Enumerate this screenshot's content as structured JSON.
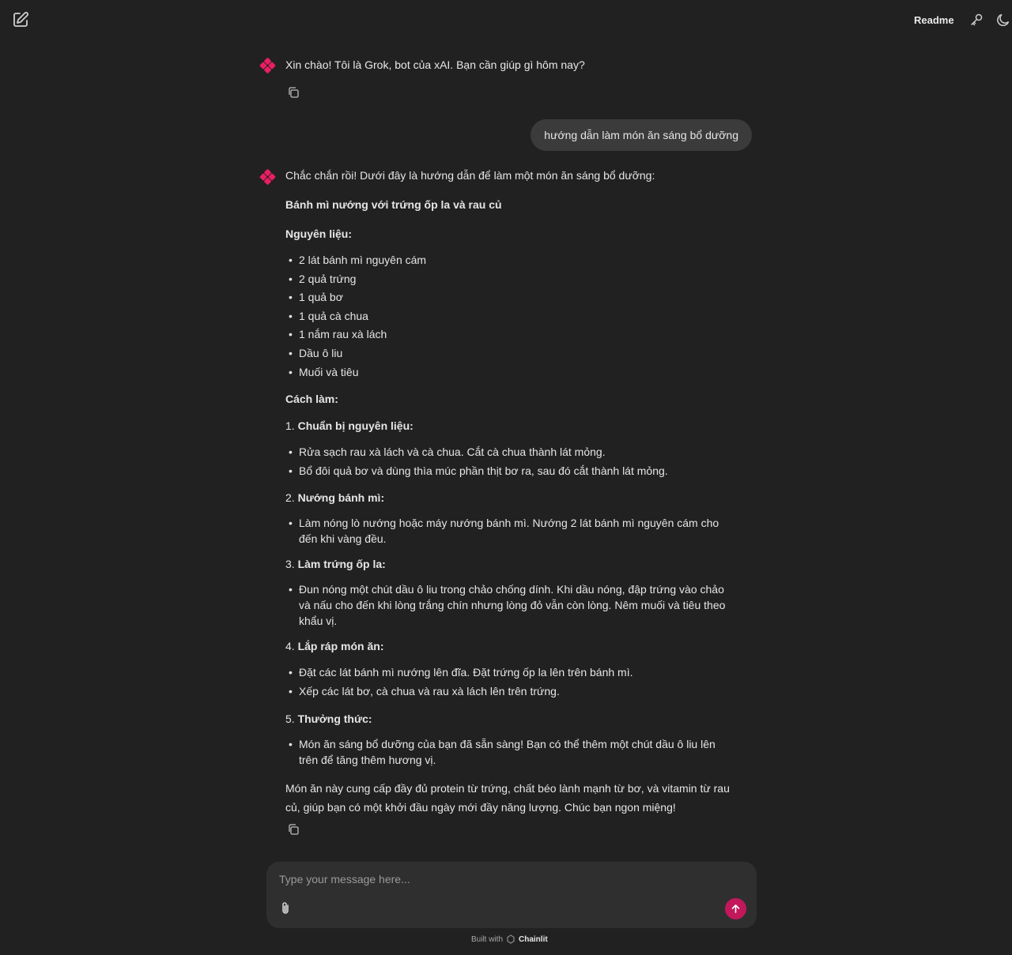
{
  "header": {
    "readme_label": "Readme"
  },
  "messages": {
    "greeting": "Xin chào! Tôi là Grok, bot của xAI. Bạn cần giúp gì hôm nay?",
    "user_message": "hướng dẫn làm món ăn sáng bổ dưỡng",
    "response": {
      "intro": "Chắc chắn rồi! Dưới đây là hướng dẫn để làm một món ăn sáng bổ dưỡng:",
      "dish_title": "Bánh mì nướng với trứng ốp la và rau củ",
      "ingredients_heading": "Nguyên liệu:",
      "ingredients": [
        "2 lát bánh mì nguyên cám",
        "2 quả trứng",
        "1 quả bơ",
        "1 quả cà chua",
        "1 nắm rau xà lách",
        "Dầu ô liu",
        "Muối và tiêu"
      ],
      "method_heading": "Cách làm:",
      "steps": [
        {
          "num": "1.",
          "title": "Chuẩn bị nguyên liệu:",
          "bullets": [
            "Rửa sạch rau xà lách và cà chua. Cắt cà chua thành lát mỏng.",
            "Bổ đôi quả bơ và dùng thìa múc phần thịt bơ ra, sau đó cắt thành lát mỏng."
          ]
        },
        {
          "num": "2.",
          "title": "Nướng bánh mì:",
          "bullets": [
            "Làm nóng lò nướng hoặc máy nướng bánh mì. Nướng 2 lát bánh mì nguyên cám cho đến khi vàng đều."
          ]
        },
        {
          "num": "3.",
          "title": "Làm trứng ốp la:",
          "bullets": [
            "Đun nóng một chút dầu ô liu trong chảo chống dính. Khi dầu nóng, đập trứng vào chảo và nấu cho đến khi lòng trắng chín nhưng lòng đỏ vẫn còn lòng. Nêm muối và tiêu theo khẩu vị."
          ]
        },
        {
          "num": "4.",
          "title": "Lắp ráp món ăn:",
          "bullets": [
            "Đặt các lát bánh mì nướng lên đĩa. Đặt trứng ốp la lên trên bánh mì.",
            "Xếp các lát bơ, cà chua và rau xà lách lên trên trứng."
          ]
        },
        {
          "num": "5.",
          "title": "Thưởng thức:",
          "bullets": [
            "Món ăn sáng bổ dưỡng của bạn đã sẵn sàng! Bạn có thể thêm một chút dầu ô liu lên trên để tăng thêm hương vị."
          ]
        }
      ],
      "closing": "Món ăn này cung cấp đầy đủ protein từ trứng, chất béo lành mạnh từ bơ, và vitamin từ rau củ, giúp bạn có một khởi đầu ngày mới đầy năng lượng. Chúc bạn ngon miệng!"
    }
  },
  "composer": {
    "placeholder": "Type your message here..."
  },
  "footer": {
    "built_with": "Built with",
    "brand": "Chainlit"
  },
  "colors": {
    "background": "#212121",
    "accent": "#c2185b",
    "avatar": "#e91e63",
    "bubble": "#3b3b3b"
  }
}
